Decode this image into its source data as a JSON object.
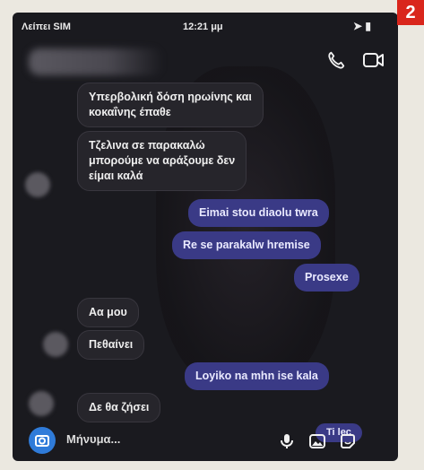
{
  "status_bar": {
    "carrier": "Λείπει SIM",
    "time": "12:21 μμ",
    "badge": "2"
  },
  "header": {
    "call_icon": "phone-icon",
    "video_icon": "video-camera-icon"
  },
  "messages": [
    {
      "dir": "in",
      "lines": [
        "Υπερβολική δόση ηρωίνης και",
        "κοκαΐνης έπαθε"
      ]
    },
    {
      "dir": "in",
      "lines": [
        "Τζελινα σε παρακαλώ",
        "μπορούμε να αράξουμε δεν",
        "είμαι καλά"
      ]
    },
    {
      "dir": "out",
      "lines": [
        "Eimai stou diaolu twra"
      ]
    },
    {
      "dir": "out",
      "lines": [
        "Re se parakalw hremise"
      ]
    },
    {
      "dir": "out",
      "lines": [
        "Prosexe"
      ]
    },
    {
      "dir": "in",
      "lines": [
        "Αα μου"
      ]
    },
    {
      "dir": "in",
      "lines": [
        "Πεθαίνει"
      ]
    },
    {
      "dir": "out",
      "lines": [
        "Loyiko na mhn ise kala"
      ]
    },
    {
      "dir": "in",
      "lines": [
        "Δε θα ζήσει"
      ]
    },
    {
      "dir": "out",
      "lines": [
        "Ti lec"
      ]
    }
  ],
  "composer": {
    "placeholder": "Μήνυμα..."
  },
  "colors": {
    "outgoing": "#3a3a86",
    "incoming": "#26252b",
    "accent": "#2f7bd9",
    "badge": "#d9261c"
  }
}
